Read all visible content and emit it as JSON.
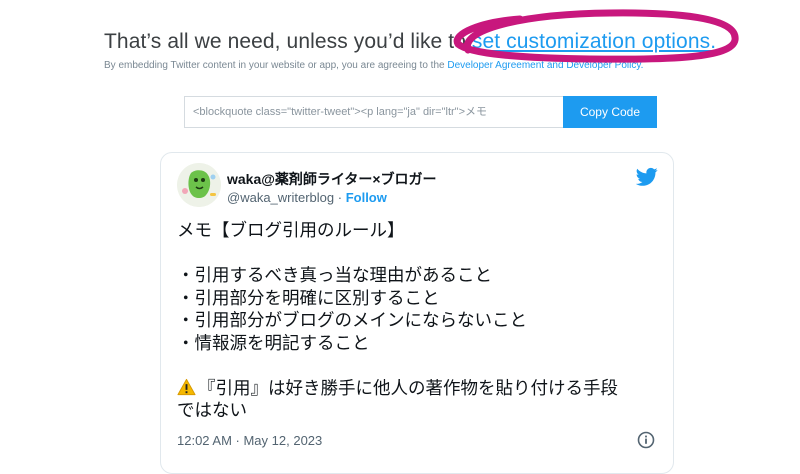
{
  "header": {
    "headline_text": "That’s all we need, unless you’d like to ",
    "headline_link": "set customization options.",
    "subline_text": "By embedding Twitter content in your website or app, you are agreeing to the ",
    "subline_link": "Developer Agreement and Developer Policy."
  },
  "embed": {
    "code_value": "<blockquote class=\"twitter-tweet\"><p lang=\"ja\" dir=\"ltr\">メモ",
    "copy_label": "Copy Code"
  },
  "tweet": {
    "display_name": "waka@薬剤師ライター×ブロガー",
    "handle": "@waka_writerblog",
    "separator": " · ",
    "follow_label": "Follow",
    "lines": {
      "l1": "メモ【ブログ引用のルール】",
      "l2": "・引用するべき真っ当な理由があること",
      "l3": "・引用部分を明確に区別すること",
      "l4": "・引用部分がブログのメインにならないこと",
      "l5": "・情報源を明記すること",
      "l6": "『引用』は好き勝手に他人の著作物を貼り付ける手段",
      "l7": "ではない"
    },
    "timestamp": "12:02 AM · May 12, 2023"
  },
  "icons": {
    "twitter": "twitter-bird-icon",
    "warning": "warning-icon",
    "info": "info-icon"
  },
  "colors": {
    "link": "#1d9bf0",
    "marker": "#c8177d",
    "button": "#1d9bf0"
  }
}
